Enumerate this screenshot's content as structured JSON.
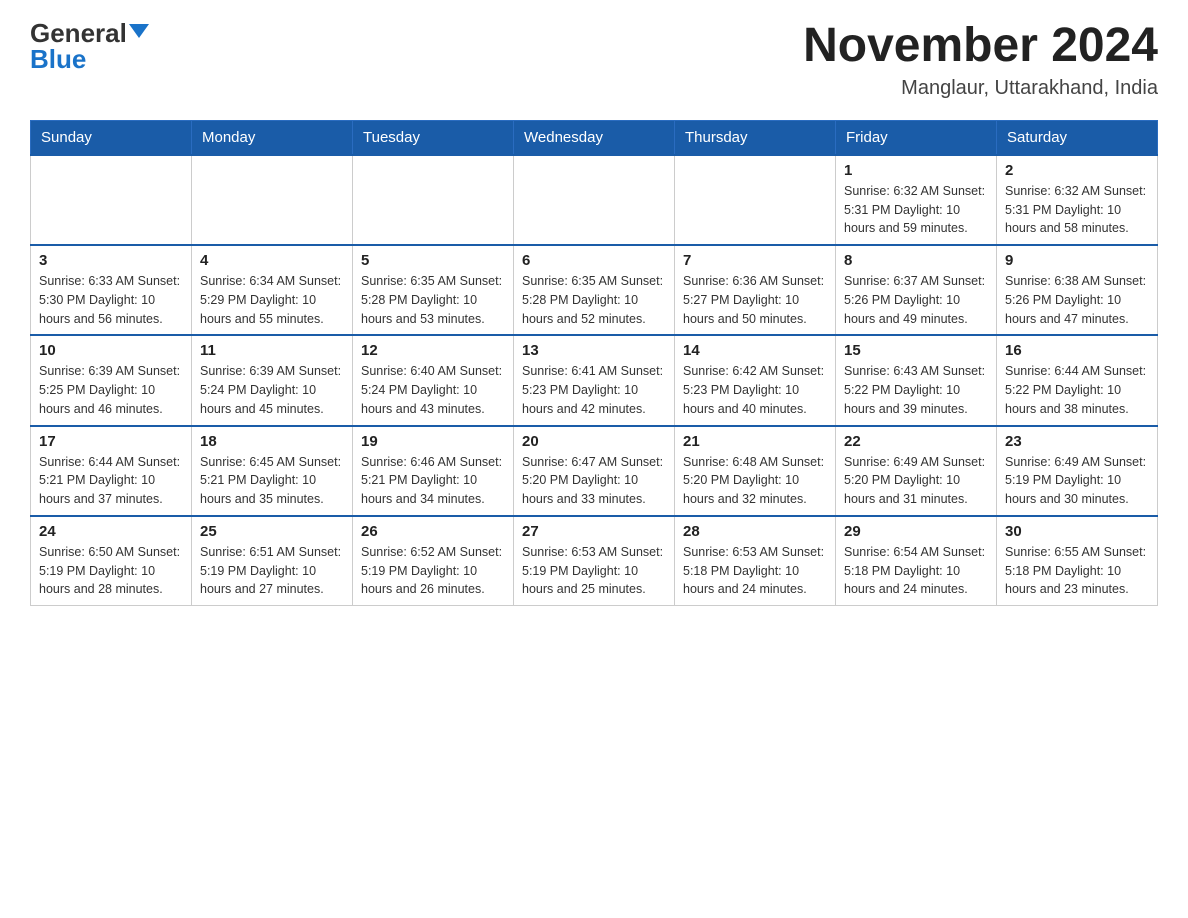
{
  "header": {
    "logo_general": "General",
    "logo_blue": "Blue",
    "month_title": "November 2024",
    "location": "Manglaur, Uttarakhand, India"
  },
  "days_of_week": [
    "Sunday",
    "Monday",
    "Tuesday",
    "Wednesday",
    "Thursday",
    "Friday",
    "Saturday"
  ],
  "weeks": [
    [
      {
        "day": "",
        "info": ""
      },
      {
        "day": "",
        "info": ""
      },
      {
        "day": "",
        "info": ""
      },
      {
        "day": "",
        "info": ""
      },
      {
        "day": "",
        "info": ""
      },
      {
        "day": "1",
        "info": "Sunrise: 6:32 AM\nSunset: 5:31 PM\nDaylight: 10 hours and 59 minutes."
      },
      {
        "day": "2",
        "info": "Sunrise: 6:32 AM\nSunset: 5:31 PM\nDaylight: 10 hours and 58 minutes."
      }
    ],
    [
      {
        "day": "3",
        "info": "Sunrise: 6:33 AM\nSunset: 5:30 PM\nDaylight: 10 hours and 56 minutes."
      },
      {
        "day": "4",
        "info": "Sunrise: 6:34 AM\nSunset: 5:29 PM\nDaylight: 10 hours and 55 minutes."
      },
      {
        "day": "5",
        "info": "Sunrise: 6:35 AM\nSunset: 5:28 PM\nDaylight: 10 hours and 53 minutes."
      },
      {
        "day": "6",
        "info": "Sunrise: 6:35 AM\nSunset: 5:28 PM\nDaylight: 10 hours and 52 minutes."
      },
      {
        "day": "7",
        "info": "Sunrise: 6:36 AM\nSunset: 5:27 PM\nDaylight: 10 hours and 50 minutes."
      },
      {
        "day": "8",
        "info": "Sunrise: 6:37 AM\nSunset: 5:26 PM\nDaylight: 10 hours and 49 minutes."
      },
      {
        "day": "9",
        "info": "Sunrise: 6:38 AM\nSunset: 5:26 PM\nDaylight: 10 hours and 47 minutes."
      }
    ],
    [
      {
        "day": "10",
        "info": "Sunrise: 6:39 AM\nSunset: 5:25 PM\nDaylight: 10 hours and 46 minutes."
      },
      {
        "day": "11",
        "info": "Sunrise: 6:39 AM\nSunset: 5:24 PM\nDaylight: 10 hours and 45 minutes."
      },
      {
        "day": "12",
        "info": "Sunrise: 6:40 AM\nSunset: 5:24 PM\nDaylight: 10 hours and 43 minutes."
      },
      {
        "day": "13",
        "info": "Sunrise: 6:41 AM\nSunset: 5:23 PM\nDaylight: 10 hours and 42 minutes."
      },
      {
        "day": "14",
        "info": "Sunrise: 6:42 AM\nSunset: 5:23 PM\nDaylight: 10 hours and 40 minutes."
      },
      {
        "day": "15",
        "info": "Sunrise: 6:43 AM\nSunset: 5:22 PM\nDaylight: 10 hours and 39 minutes."
      },
      {
        "day": "16",
        "info": "Sunrise: 6:44 AM\nSunset: 5:22 PM\nDaylight: 10 hours and 38 minutes."
      }
    ],
    [
      {
        "day": "17",
        "info": "Sunrise: 6:44 AM\nSunset: 5:21 PM\nDaylight: 10 hours and 37 minutes."
      },
      {
        "day": "18",
        "info": "Sunrise: 6:45 AM\nSunset: 5:21 PM\nDaylight: 10 hours and 35 minutes."
      },
      {
        "day": "19",
        "info": "Sunrise: 6:46 AM\nSunset: 5:21 PM\nDaylight: 10 hours and 34 minutes."
      },
      {
        "day": "20",
        "info": "Sunrise: 6:47 AM\nSunset: 5:20 PM\nDaylight: 10 hours and 33 minutes."
      },
      {
        "day": "21",
        "info": "Sunrise: 6:48 AM\nSunset: 5:20 PM\nDaylight: 10 hours and 32 minutes."
      },
      {
        "day": "22",
        "info": "Sunrise: 6:49 AM\nSunset: 5:20 PM\nDaylight: 10 hours and 31 minutes."
      },
      {
        "day": "23",
        "info": "Sunrise: 6:49 AM\nSunset: 5:19 PM\nDaylight: 10 hours and 30 minutes."
      }
    ],
    [
      {
        "day": "24",
        "info": "Sunrise: 6:50 AM\nSunset: 5:19 PM\nDaylight: 10 hours and 28 minutes."
      },
      {
        "day": "25",
        "info": "Sunrise: 6:51 AM\nSunset: 5:19 PM\nDaylight: 10 hours and 27 minutes."
      },
      {
        "day": "26",
        "info": "Sunrise: 6:52 AM\nSunset: 5:19 PM\nDaylight: 10 hours and 26 minutes."
      },
      {
        "day": "27",
        "info": "Sunrise: 6:53 AM\nSunset: 5:19 PM\nDaylight: 10 hours and 25 minutes."
      },
      {
        "day": "28",
        "info": "Sunrise: 6:53 AM\nSunset: 5:18 PM\nDaylight: 10 hours and 24 minutes."
      },
      {
        "day": "29",
        "info": "Sunrise: 6:54 AM\nSunset: 5:18 PM\nDaylight: 10 hours and 24 minutes."
      },
      {
        "day": "30",
        "info": "Sunrise: 6:55 AM\nSunset: 5:18 PM\nDaylight: 10 hours and 23 minutes."
      }
    ]
  ]
}
